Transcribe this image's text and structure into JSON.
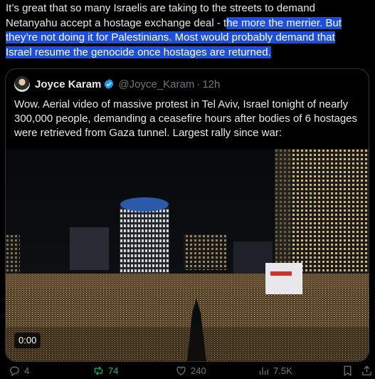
{
  "tweet": {
    "text_plain": "It’s great that so many Israelis are taking to the streets to demand Netanyahu accept a hostage exchange deal - t",
    "text_selected_1": "he more the merrier. But",
    "text_selected_2": "they’re not doing it for Palestinians. Most would probably demand that",
    "text_selected_3": "Israel resume the genocide once hostages are returned."
  },
  "quote": {
    "author_name": "Joyce Karam",
    "handle": "@Joyce_Karam",
    "separator": "·",
    "time": "12h",
    "text": "Wow. Aerial video of massive protest in Tel Aviv, Israel tonight of nearly 300,000 people, demanding a ceasefire hours after bodies of 6 hostages were retrieved from Gaza tunnel. Largest rally since war:",
    "video_timestamp": "0:00"
  },
  "actions": {
    "replies": "4",
    "reposts": "74",
    "likes": "240",
    "views": "7.5K"
  },
  "colors": {
    "selection": "#1d4fd8",
    "repost": "#00ba7c",
    "muted": "#71767b",
    "verified": "#1d9bf0"
  }
}
